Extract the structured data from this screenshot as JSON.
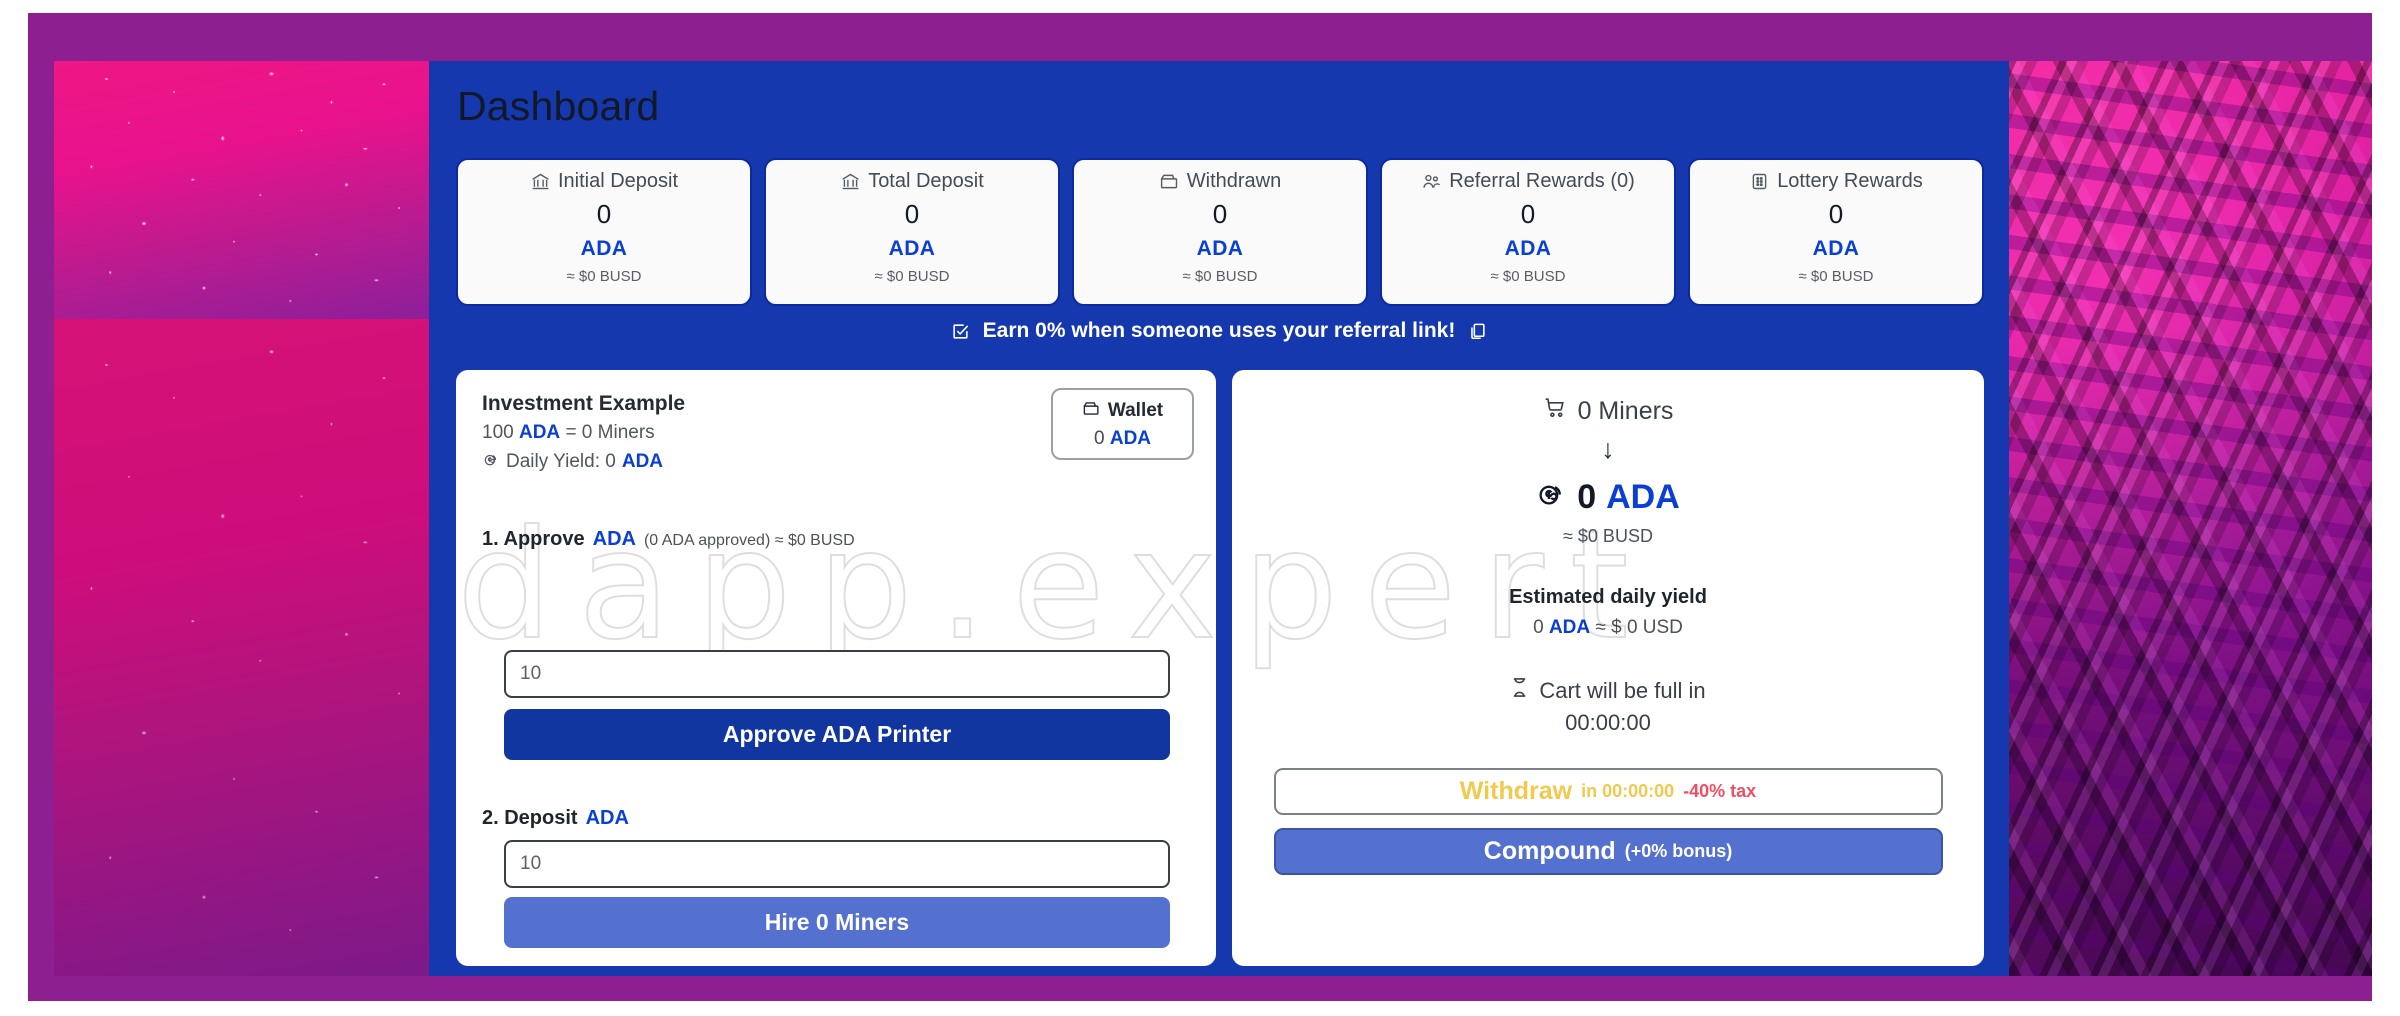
{
  "theme": {
    "frame_purple": "#8e1f91",
    "panel_blue": "#1638ae",
    "accent_blue": "#0b3fd4",
    "button_blue": "#12369f",
    "button_soft_blue": "#5571cf",
    "withdraw_yellow": "#f0c94f",
    "tax_red": "#ef4e63"
  },
  "watermark": {
    "text": "dapp.expert"
  },
  "header": {
    "title": "Dashboard"
  },
  "stats": [
    {
      "icon": "bank-icon",
      "label": "Initial Deposit",
      "value": "0",
      "currency": "ADA",
      "approx": "≈ $0 BUSD"
    },
    {
      "icon": "bank-icon",
      "label": "Total Deposit",
      "value": "0",
      "currency": "ADA",
      "approx": "≈ $0 BUSD"
    },
    {
      "icon": "wallet-icon",
      "label": "Withdrawn",
      "value": "0",
      "currency": "ADA",
      "approx": "≈ $0 BUSD"
    },
    {
      "icon": "people-icon",
      "label": "Referral Rewards (0)",
      "value": "0",
      "currency": "ADA",
      "approx": "≈ $0 BUSD"
    },
    {
      "icon": "ticket-icon",
      "label": "Lottery Rewards",
      "value": "0",
      "currency": "ADA",
      "approx": "≈ $0 BUSD"
    }
  ],
  "referral": {
    "icon": "checkbox-icon",
    "text": "Earn 0% when someone uses your referral link!",
    "copy_icon": "copy-icon"
  },
  "left_panel": {
    "investment": {
      "title": "Investment Example",
      "amount": "100",
      "currency": "ADA",
      "equals": "= 0 Miners",
      "yield_icon": "coin-icon",
      "yield_label": "Daily Yield: 0",
      "yield_currency": "ADA"
    },
    "wallet": {
      "icon": "wallet-icon",
      "label": "Wallet",
      "value": "0",
      "currency": "ADA"
    },
    "step1": {
      "label": "1. Approve",
      "currency": "ADA",
      "detail": "(0 ADA approved) ≈ $0 BUSD",
      "input_placeholder": "10",
      "input_value": "",
      "button_label": "Approve ADA Printer"
    },
    "step2": {
      "label": "2. Deposit",
      "currency": "ADA",
      "input_placeholder": "10",
      "input_value": "",
      "button_label": "Hire 0 Miners"
    }
  },
  "right_panel": {
    "miners": {
      "icon": "cart-icon",
      "label": "0 Miners"
    },
    "arrow": "↓",
    "balance": {
      "icon": "coins-icon",
      "value": "0",
      "currency": "ADA",
      "approx": "≈ $0 BUSD"
    },
    "estimated_yield": {
      "title": "Estimated daily yield",
      "value": "0",
      "currency": "ADA",
      "approx": "≈ $ 0 USD"
    },
    "cart_timer": {
      "icon": "hourglass-icon",
      "label": "Cart will be full in",
      "time": "00:00:00"
    },
    "withdraw_button": {
      "label": "Withdraw",
      "sub": "in 00:00:00",
      "tax": "-40% tax"
    },
    "compound_button": {
      "label": "Compound",
      "sub": "(+0% bonus)"
    }
  }
}
